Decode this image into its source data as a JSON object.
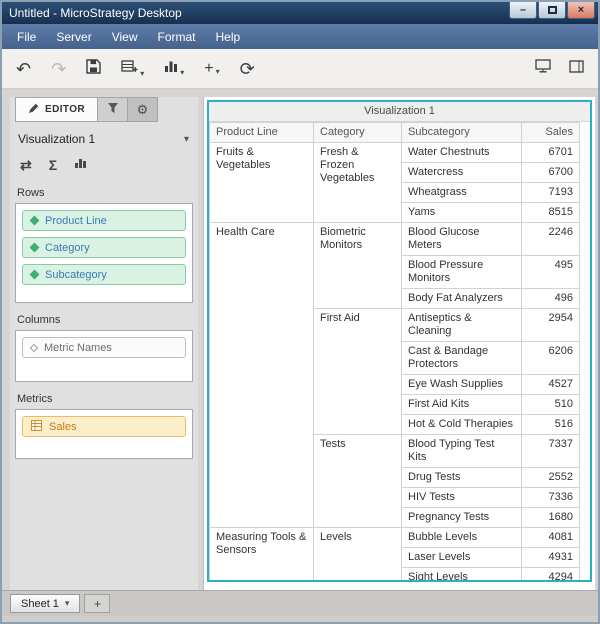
{
  "window": {
    "title": "Untitled - MicroStrategy Desktop"
  },
  "icons": {
    "minimize": "–",
    "close": "×",
    "back": "↶",
    "forward": "↷",
    "refresh": "⟳",
    "caret": "▾",
    "sigma": "Σ",
    "gear": "⚙",
    "pivot": "⇄",
    "plus": "+"
  },
  "menu_bar": {
    "items": [
      "File",
      "Server",
      "View",
      "Format",
      "Help"
    ]
  },
  "toolbar": {
    "icons": [
      "undo",
      "redo",
      "save",
      "add-data",
      "insert-visualization",
      "insert",
      "refresh",
      "presentation",
      "panels"
    ]
  },
  "editor_panel": {
    "tabs": {
      "editor": "EDITOR"
    },
    "visualization_selector": {
      "value": "Visualization 1"
    },
    "rows": {
      "label": "Rows",
      "items": [
        {
          "label": "Product Line"
        },
        {
          "label": "Category"
        },
        {
          "label": "Subcategory"
        }
      ]
    },
    "columns": {
      "label": "Columns",
      "items": [
        {
          "label": "Metric Names"
        }
      ]
    },
    "metrics": {
      "label": "Metrics",
      "items": [
        {
          "label": "Sales"
        }
      ]
    }
  },
  "visualization": {
    "title": "Visualization 1",
    "columns": [
      "Product Line",
      "Category",
      "Subcategory",
      "Sales"
    ],
    "groups": [
      {
        "product_line": "Fruits & Vegetables",
        "categories": [
          {
            "name": "Fresh & Frozen Vegetables",
            "rows": [
              [
                "Water Chestnuts",
                6701
              ],
              [
                "Watercress",
                6700
              ],
              [
                "Wheatgrass",
                7193
              ],
              [
                "Yams",
                8515
              ]
            ]
          }
        ]
      },
      {
        "product_line": "Health Care",
        "categories": [
          {
            "name": "Biometric Monitors",
            "rows": [
              [
                "Blood Glucose Meters",
                2246
              ],
              [
                "Blood Pressure Monitors",
                495
              ],
              [
                "Body Fat Analyzers",
                496
              ]
            ]
          },
          {
            "name": "First Aid",
            "rows": [
              [
                "Antiseptics & Cleaning",
                2954
              ],
              [
                "Cast & Bandage Protectors",
                6206
              ],
              [
                "Eye Wash Supplies",
                4527
              ],
              [
                "First Aid Kits",
                510
              ],
              [
                "Hot & Cold Therapies",
                516
              ]
            ]
          },
          {
            "name": "Tests",
            "rows": [
              [
                "Blood Typing Test Kits",
                7337
              ],
              [
                "Drug Tests",
                2552
              ],
              [
                "HIV Tests",
                7336
              ],
              [
                "Pregnancy Tests",
                1680
              ]
            ]
          }
        ]
      },
      {
        "product_line": "Measuring Tools & Sensors",
        "categories": [
          {
            "name": "Levels",
            "rows": [
              [
                "Bubble Levels",
                4081
              ],
              [
                "Laser Levels",
                4931
              ],
              [
                "Sight Levels",
                4294
              ]
            ]
          }
        ]
      }
    ]
  },
  "sheet_bar": {
    "sheet_label": "Sheet 1",
    "add_label": "+"
  },
  "colors": {
    "title_bar": "#1d3a5f",
    "menu_bar": "#46638d",
    "selection_border": "#2ab0c6",
    "attribute_pill": "#daf2e4",
    "metric_pill": "#fdeecb"
  }
}
